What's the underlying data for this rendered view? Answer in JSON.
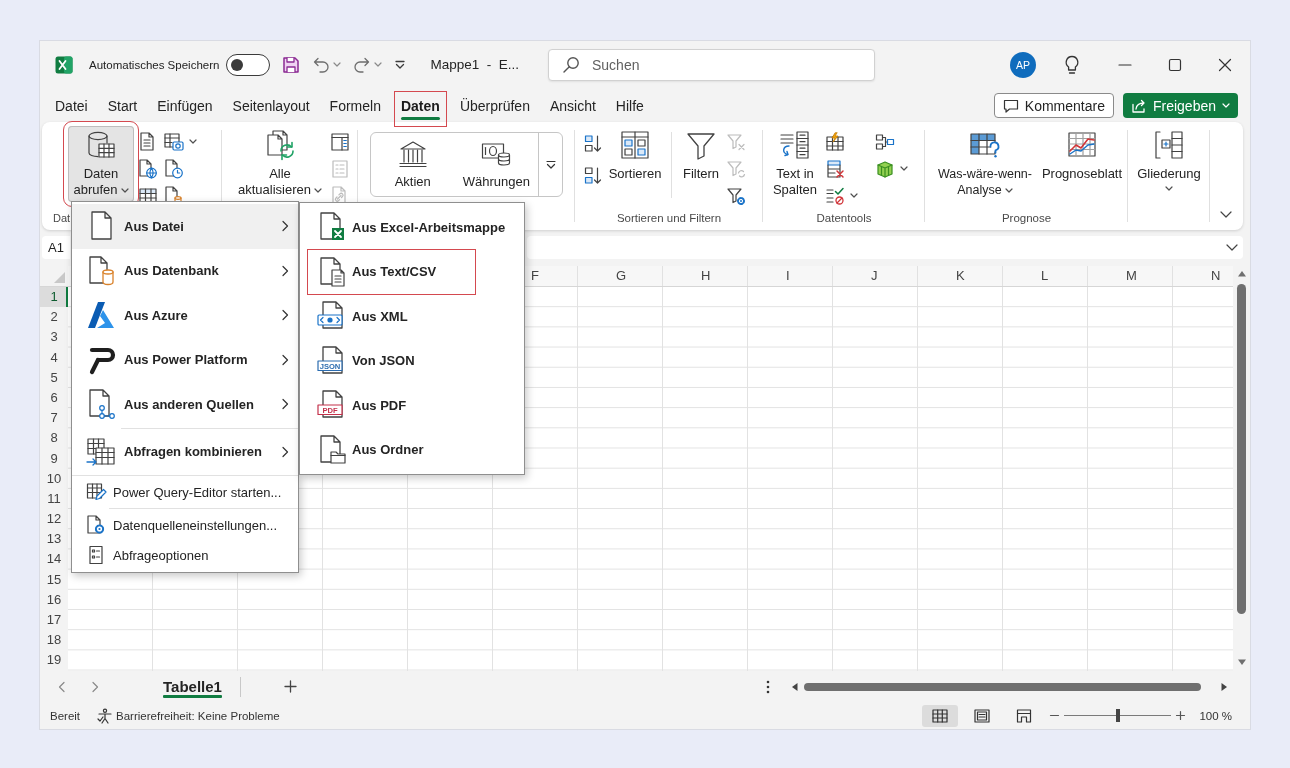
{
  "title_bar": {
    "autosave": {
      "label": "Automatisches Speichern",
      "on": false
    },
    "document_title": "Mappe1  -  E...",
    "search": {
      "placeholder": "Suchen"
    },
    "account_initials": "AP"
  },
  "ribbon_tabs": [
    {
      "label": "Datei",
      "selected": false,
      "outlined": false
    },
    {
      "label": "Start",
      "selected": false,
      "outlined": false
    },
    {
      "label": "Einfügen",
      "selected": false,
      "outlined": false
    },
    {
      "label": "Seitenlayout",
      "selected": false,
      "outlined": false
    },
    {
      "label": "Formeln",
      "selected": false,
      "outlined": false
    },
    {
      "label": "Daten",
      "selected": true,
      "outlined": true
    },
    {
      "label": "Überprüfen",
      "selected": false,
      "outlined": false
    },
    {
      "label": "Ansicht",
      "selected": false,
      "outlined": false
    },
    {
      "label": "Hilfe",
      "selected": false,
      "outlined": false
    }
  ],
  "ribbon_actions": {
    "comments": "Kommentare",
    "share": "Freigeben"
  },
  "ribbon": {
    "groups": [
      {
        "kind": "get_data",
        "label": "Dat",
        "get_data_button": {
          "label": "Daten abrufen",
          "expanded": true,
          "outlined": true
        }
      },
      {
        "kind": "queries",
        "refresh_button": "Alle aktualisieren",
        "small_buttons": [
          {
            "disabled": false
          },
          {
            "disabled": true
          },
          {
            "disabled": true
          }
        ]
      },
      {
        "kind": "data_types",
        "types": [
          "Aktien",
          "Währungen"
        ]
      },
      {
        "kind": "sort_filter",
        "label": "Sortieren und Filtern",
        "sort_button": "Sortieren",
        "filter_button": "Filtern",
        "filter_tools": [
          {
            "disabled": true
          },
          {
            "disabled": true
          },
          {
            "disabled": false
          }
        ]
      },
      {
        "kind": "data_tools",
        "label": "Datentools",
        "text_to_columns_button": "Text in Spalten"
      },
      {
        "kind": "forecast",
        "label": "Prognose",
        "what_if_button": "Was-wäre-wenn-Analyse",
        "forecast_sheet_button": "Prognoseblatt"
      },
      {
        "kind": "outline",
        "outline_button": "Gliederung"
      }
    ]
  },
  "name_box": "A1",
  "sheet": {
    "columns": [
      "F",
      "G",
      "H",
      "I",
      "J",
      "K",
      "L",
      "M",
      "N"
    ],
    "rows": [
      {
        "label": "1",
        "selected": true
      },
      {
        "label": "2",
        "selected": false
      },
      {
        "label": "3",
        "selected": false
      },
      {
        "label": "4",
        "selected": false
      },
      {
        "label": "5",
        "selected": false
      },
      {
        "label": "6",
        "selected": false
      },
      {
        "label": "7",
        "selected": false
      },
      {
        "label": "8",
        "selected": false
      },
      {
        "label": "9",
        "selected": false
      },
      {
        "label": "10",
        "selected": false
      },
      {
        "label": "11",
        "selected": false
      },
      {
        "label": "12",
        "selected": false
      },
      {
        "label": "13",
        "selected": false
      },
      {
        "label": "14",
        "selected": false
      },
      {
        "label": "15",
        "selected": false
      },
      {
        "label": "16",
        "selected": false
      },
      {
        "label": "17",
        "selected": false
      },
      {
        "label": "18",
        "selected": false
      },
      {
        "label": "19",
        "selected": false
      }
    ]
  },
  "get_data_menu": {
    "sections": [
      [
        {
          "kind": "submenu",
          "label": "Aus Datei",
          "selected": true
        },
        {
          "kind": "submenu",
          "label": "Aus Datenbank",
          "selected": false
        },
        {
          "kind": "submenu",
          "label": "Aus Azure",
          "selected": false
        },
        {
          "kind": "submenu",
          "label": "Aus Power Platform",
          "selected": false
        },
        {
          "kind": "submenu",
          "label": "Aus anderen Quellen",
          "selected": false
        }
      ],
      [
        {
          "kind": "submenu",
          "label": "Abfragen kombinieren",
          "selected": false
        }
      ],
      [
        {
          "kind": "command",
          "label": "Power Query-Editor starten...",
          "selected": false
        }
      ],
      [
        {
          "kind": "command",
          "label": "Datenquelleneinstellungen...",
          "selected": false
        },
        {
          "kind": "command",
          "label": "Abfrageoptionen",
          "selected": false
        }
      ]
    ]
  },
  "file_submenu": {
    "items": [
      {
        "label": "Aus Excel-Arbeitsmappe",
        "selected": false,
        "outlined": false
      },
      {
        "label": "Aus Text/CSV",
        "selected": false,
        "outlined": true
      },
      {
        "label": "Aus XML",
        "selected": false,
        "outlined": false
      },
      {
        "label": "Von JSON",
        "badge": "JSON",
        "selected": false,
        "outlined": false
      },
      {
        "label": "Aus PDF",
        "badge": "PDF",
        "selected": false,
        "outlined": false
      },
      {
        "label": "Aus Ordner",
        "selected": false,
        "outlined": false
      }
    ]
  },
  "sheet_tabs": [
    {
      "label": "Tabelle1",
      "selected": true
    }
  ],
  "status_bar": {
    "status": "Bereit",
    "accessibility": "Barrierefreiheit: Keine Probleme",
    "views": [
      {
        "selected": true
      },
      {
        "selected": false
      },
      {
        "selected": false
      }
    ],
    "zoom": {
      "level": 0.5,
      "reading": "100 %"
    }
  }
}
